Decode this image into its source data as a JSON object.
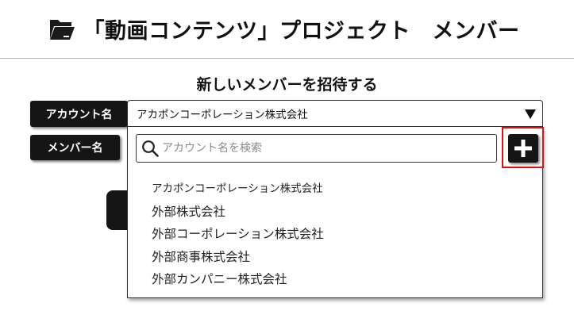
{
  "header": {
    "title": "「動画コンテンツ」プロジェクト　メンバー",
    "icon": "folder-open-icon"
  },
  "invite": {
    "section_title": "新しいメンバーを招待する",
    "account_label": "アカウント名",
    "member_label": "メンバー名"
  },
  "account_select": {
    "selected_value": "アカポンコーポレーション株式会社",
    "icon": "chevron-down-icon"
  },
  "dropdown": {
    "search_placeholder": "アカウント名を検索",
    "search_value": "",
    "options": [
      "アカポンコーポレーション株式会社",
      "外部株式会社",
      "外部コーポレーション株式会社",
      "外部商事株式会社",
      "外部カンパニー株式会社"
    ]
  },
  "add_button": {
    "icon": "plus-icon",
    "highlight_color": "#e01010"
  },
  "colors": {
    "label_background": "#151515",
    "label_text": "#ffffff",
    "border": "#333333",
    "placeholder": "#8a8a8a"
  }
}
